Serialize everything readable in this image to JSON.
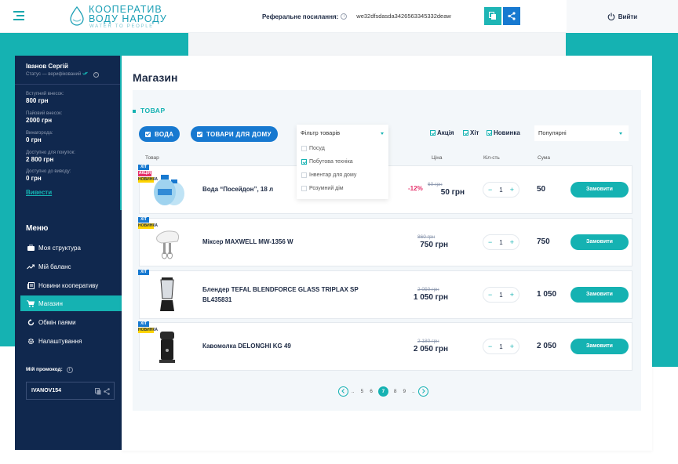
{
  "header": {
    "logo_line1": "КООПЕРАТИВ",
    "logo_line2": "ВОДУ НАРОДУ",
    "logo_tagline": "WATER TO PEOPLE",
    "referral_label": "Реферальне посилання:",
    "referral_value": "we32dfsdasda3426563345332deaw",
    "logout_label": "Вийти"
  },
  "colors": {
    "teal": "#15b2b2",
    "blue": "#1779d0",
    "navy": "#10284e",
    "pink": "#e5306a",
    "yellow": "#ffd400"
  },
  "user": {
    "name": "Іванов Сергій",
    "status": "Статус — верифікований"
  },
  "stats": [
    {
      "label": "Вступний внесок:",
      "value": "800 грн"
    },
    {
      "label": "Пайовий внесок:",
      "value": "2000 грн"
    },
    {
      "label": "Винагорода:",
      "value": "0 грн"
    },
    {
      "label": "Доступно для покупок:",
      "value": "2 800 грн"
    },
    {
      "label": "Доступно до виводу:",
      "value": "0 грн"
    }
  ],
  "withdraw_label": "Вивести",
  "menu": {
    "title": "Меню",
    "items": [
      {
        "label": "Моя структура",
        "icon": "briefcase-icon"
      },
      {
        "label": "Мій баланс",
        "icon": "trend-icon"
      },
      {
        "label": "Новини кооперативу",
        "icon": "news-icon"
      },
      {
        "label": "Магазин",
        "icon": "cart-icon"
      },
      {
        "label": "Обмін паями",
        "icon": "refresh-icon"
      },
      {
        "label": "Налаштування",
        "icon": "gear-icon"
      }
    ],
    "active": "Магазин"
  },
  "promo": {
    "label": "Мій промокод:",
    "code": "IVANOV154"
  },
  "page": {
    "title": "Магазин",
    "section": "ТОВАР"
  },
  "categories": [
    "ВОДА",
    "ТОВАРИ ДЛЯ ДОМУ"
  ],
  "filter": {
    "placeholder": "Фільтр товарів",
    "options": [
      {
        "label": "Посуд",
        "checked": false
      },
      {
        "label": "Побутова техніка",
        "checked": true
      },
      {
        "label": "Інвентар для дому",
        "checked": false
      },
      {
        "label": "Розумний дім",
        "checked": false
      }
    ]
  },
  "tags": [
    "Акція",
    "Хіт",
    "Новинка"
  ],
  "sort": {
    "value": "Популярні"
  },
  "columns": {
    "product": "Товар",
    "price": "Ціна",
    "qty": "Кіл-сть",
    "sum": "Сума"
  },
  "badges": {
    "hit": "ХІТ",
    "akc": "АКЦІЯ",
    "new": "НОВИНКА"
  },
  "products": [
    {
      "name": "Вода “Посейдон”, 18 л",
      "discount": "-12%",
      "old_price": "60 грн",
      "price": "50 грн",
      "qty": "1",
      "sum": "50",
      "badges": [
        "hit",
        "akc",
        "new"
      ]
    },
    {
      "name": "Міксер MAXWELL MW-1356 W",
      "discount": "",
      "old_price": "860 грн",
      "price": "750 грн",
      "qty": "1",
      "sum": "750",
      "badges": [
        "hit",
        "new"
      ]
    },
    {
      "name": "Блендер TEFAL BLENDFORCE GLASS TRIPLAX SP BL435831",
      "discount": "",
      "old_price": "2 050 грн",
      "price": "1 050 грн",
      "qty": "1",
      "sum": "1 050",
      "badges": [
        "hit"
      ]
    },
    {
      "name": "Кавомолка DELONGHI KG 49",
      "discount": "",
      "old_price": "2 180 грн",
      "price": "2 050 грн",
      "qty": "1",
      "sum": "2 050",
      "badges": [
        "hit",
        "new"
      ]
    }
  ],
  "order_label": "Замовити",
  "pagination": {
    "items": [
      "..",
      "5",
      "6",
      "7",
      "8",
      "9",
      ".."
    ],
    "active": "7"
  }
}
